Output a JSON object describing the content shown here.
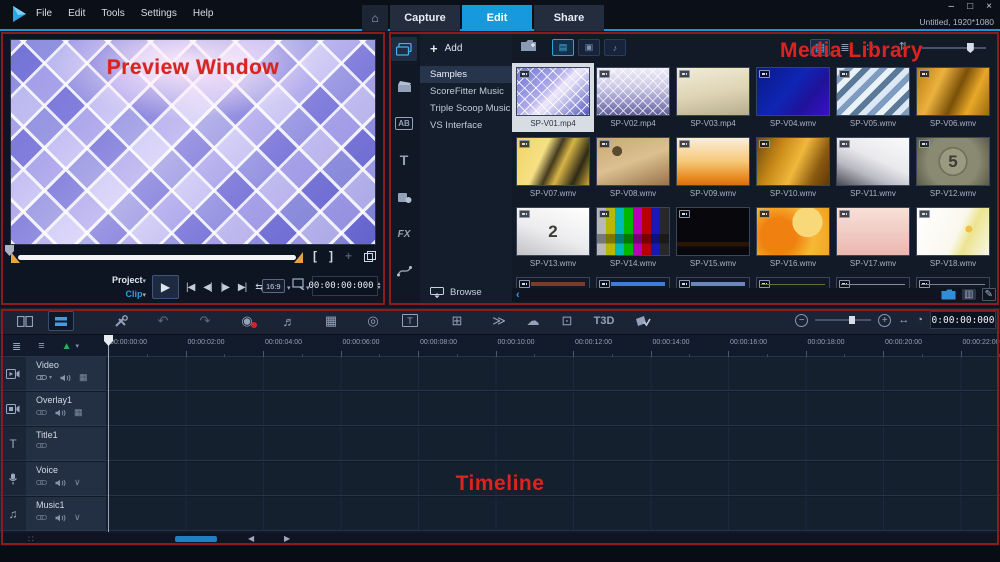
{
  "titlebar": {
    "menus": [
      "File",
      "Edit",
      "Tools",
      "Settings",
      "Help"
    ],
    "tabs": [
      {
        "label": "Capture"
      },
      {
        "label": "Edit",
        "active": true
      },
      {
        "label": "Share"
      }
    ],
    "doc_title": "Untitled, 1920*1080"
  },
  "icons": {
    "home": "⌂",
    "minimize": "–",
    "restore": "□",
    "close": "×",
    "add": "+",
    "sort": "⇅",
    "thumb_view": "▤",
    "list_view": "≣",
    "grid_view": "∷",
    "film_filter": "▤",
    "photo_filter": "▣",
    "audio_filter": "♪",
    "storyboard": "▤",
    "timeline_view": "▤",
    "undo": "↶",
    "redo": "↷",
    "reel": "◉",
    "mixer": "♬",
    "frames": "▦",
    "disc": "◎",
    "grid": "⊞",
    "runner": "≫",
    "cloud": "☁",
    "tracker": "⊡",
    "mask": "✓",
    "zoom_out": "−",
    "zoom_in": "+",
    "fit": "↔",
    "clock": "◔",
    "track_manager": "≣",
    "add_track": "≡",
    "marker": "▲",
    "caret": "▾",
    "chevron": "∨",
    "blend": "▦",
    "music_note": "♫",
    "title_t": "T",
    "mark_in": "[",
    "mark_out": "]",
    "split": "+",
    "scroll_left": "‹",
    "panel": "▥",
    "pencil": "✎",
    "arrow_left": "◀",
    "arrow_right": "▶",
    "corner": "∷"
  },
  "annotations": {
    "preview": "Preview Window",
    "media_library": "Media Library",
    "timeline": "Timeline"
  },
  "colors": {
    "accent_blue": "#1799dd",
    "annotation_red": "#da2420",
    "selected_thumb_bg": "#d8dce3"
  },
  "preview": {
    "mode_project": "Project",
    "mode_clip": "Clip",
    "transport": {
      "play": "▶",
      "go_start": "|◀",
      "prev_frame": "◀|",
      "next_frame": "|▶",
      "go_end": "▶|",
      "loop": "⇆"
    },
    "aspect": "16:9",
    "timecode": "00:00:00:000"
  },
  "library": {
    "add_label": "Add",
    "folders": [
      {
        "label": "Samples",
        "selected": true
      },
      {
        "label": "ScoreFitter Music"
      },
      {
        "label": "Triple Scoop Music"
      },
      {
        "label": "VS Interface"
      }
    ],
    "nav_labels": {
      "transition": "AB",
      "title": "T",
      "fx": "FX"
    },
    "browse_label": "Browse",
    "thumbs": [
      {
        "name": "SP-V01.mp4",
        "selected": true,
        "bg": "repeating-linear-gradient(45deg, rgba(255,255,255,.85) 0 1px, transparent 1px 8px), repeating-linear-gradient(-45deg, rgba(255,255,255,.85) 0 1px, transparent 1px 8px), linear-gradient(135deg,#6d72d2 0%,#aca8e8 40%,#eee8fb 55%,#5258be 100%)"
      },
      {
        "name": "SP-V02.mp4",
        "bg": "repeating-linear-gradient(45deg, rgba(255,255,255,.7) 0 1px, transparent 1px 7px), repeating-linear-gradient(-45deg, rgba(255,255,255,.7) 0 1px, transparent 1px 7px), linear-gradient(180deg,#efecf8 0%,#cdc9e6 40%,#8f8dc2 75%,#605e94 100%)"
      },
      {
        "name": "SP-V03.mp4",
        "bg": "linear-gradient(170deg,#f2ecd8 0%,#ddd3b4 55%,#b6ad8e 100%)"
      },
      {
        "name": "SP-V04.wmv",
        "bg": "linear-gradient(130deg,#081a86 0%,#0f25b4 45%,#20129a 70%,#3a10c8 100%)"
      },
      {
        "name": "SP-V05.wmv",
        "bg": "repeating-linear-gradient(135deg,#dce8f4 0 6px,#7d9cc0 6px 12px,#eaf2fa 12px 18px,#5a7898 18px 24px)"
      },
      {
        "name": "SP-V06.wmv",
        "bg": "linear-gradient(115deg,#b87a14 0%,#ecb23e 30%,#7a5008 55%,#e8a828 75%,#9a6a10 100%)"
      },
      {
        "name": "SP-V07.wmv",
        "bg": "linear-gradient(115deg,#f0d468 0%,#f6e084 35%,#433a1e 50%,#d8b448 62%,#2e2a16 82%,#caa838 100%)"
      },
      {
        "name": "SP-V08.wmv",
        "bg": "radial-gradient(circle at 28% 28%, #5a4a30 0 8%, transparent 8%), linear-gradient(160deg,#c8a874 0%,#dcc090 50%,#96744a 100%)"
      },
      {
        "name": "SP-V09.wmv",
        "bg": "linear-gradient(180deg,#faeeda 0%,#f6c878 50%,#e88a20 85%,#d87010 100%)"
      },
      {
        "name": "SP-V10.wmv",
        "bg": "linear-gradient(115deg,#6a4a0e 0%,#c88818 30%,#f0b83c 55%,#8a5a10 80%,#5a3a08 100%)"
      },
      {
        "name": "SP-V11.wmv",
        "bg": "linear-gradient(205deg,#fbfbfc 0%,#e9e9ec 45%,#b9b9c2 70%,#4a4a55 100%)"
      },
      {
        "name": "SP-V12.wmv",
        "overlay": "5",
        "bg": "radial-gradient(circle at 50% 50%, #9a9a80 0 30%, #70705a 30% 34%, #8a8a72 34% 60%, #5a5a48 100%)"
      },
      {
        "name": "SP-V13.wmv",
        "overlay": "2",
        "bg": "linear-gradient(200deg,#ffffff 0%,#ececee 55%,#c2c2c8 100%)"
      },
      {
        "name": "SP-V14.wmv",
        "bg": "linear-gradient(180deg, rgba(0,0,0,0) 0 55%, rgba(0,0,0,.35) 55% 75%, rgba(0,0,0,0) 75%), linear-gradient(90deg,#b8b8b8 0 12.5%,#b8b800 12.5% 25%,#00b8b8 25% 37.5%,#00b800 37.5% 50%,#b800b8 50% 62.5%,#b80000 62.5% 75%,#1818b8 75% 87.5%,#282828 87.5% 100%)"
      },
      {
        "name": "SP-V15.wmv",
        "bg": "linear-gradient(180deg,#08080c 0 72%,#2a1404 72% 82%,#08080c 82% 100%)"
      },
      {
        "name": "SP-V16.wmv",
        "bg": "radial-gradient(circle at 70% 30%, #f8d878 0 25%, transparent 25%), radial-gradient(circle at 30% 60%, #f08010 0 30%, #f8b838 60%, #f0a020 100%)"
      },
      {
        "name": "SP-V17.wmv",
        "bg": "linear-gradient(180deg,#f8e0d8 0%,#f0ccc4 50%,#eab8b0 100%)"
      },
      {
        "name": "SP-V18.wmv",
        "bg": "radial-gradient(circle at 72% 45%, #f0c040 0 6%, transparent 6%), linear-gradient(115deg,#ffffff 0%,#faf8ee 55%,#ece490 70%,#f8f6ea 100%)"
      }
    ],
    "audio_items": [
      {
        "bar": "#7c3c2a"
      },
      {
        "bar": "#3f7cd8"
      },
      {
        "bar": "#6c86bc"
      },
      {
        "bar": "#6e6e30",
        "thin": true
      },
      {
        "bar": "#8c8c94",
        "thin": true
      },
      {
        "bar": "#80808a",
        "thin": true
      }
    ]
  },
  "timeline": {
    "ruler_ticks": [
      "00:00:00:00",
      "00:00:02:00",
      "00:00:04:00",
      "00:00:06:00",
      "00:00:08:00",
      "00:00:10:00",
      "00:00:12:00",
      "00:00:14:00",
      "00:00:16:00",
      "00:00:18:00",
      "00:00:20:00",
      "00:00:22:00"
    ],
    "tracks": [
      {
        "name": "Video"
      },
      {
        "name": "Overlay1"
      },
      {
        "name": "Title1"
      },
      {
        "name": "Voice"
      },
      {
        "name": "Music1"
      }
    ],
    "t3d_label": "T3D",
    "timecode": "0:00:00:000"
  }
}
